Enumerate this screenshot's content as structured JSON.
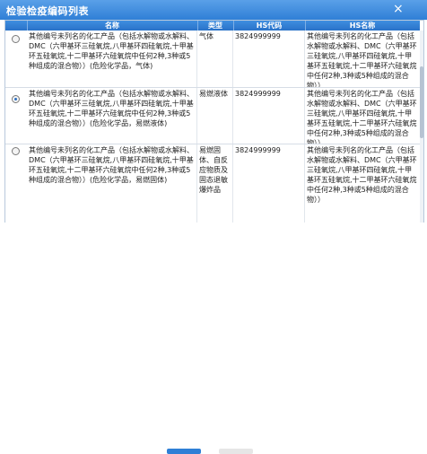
{
  "dialog": {
    "title": "检验检疫编码列表",
    "close_glyph": "×"
  },
  "table": {
    "headers": [
      "名称",
      "类型",
      "HS代码",
      "HS名称"
    ],
    "rows": [
      {
        "selected": false,
        "name": "其他编号未列名的化工产品（包括水解物或水解料、DMC（六甲基环三硅氧烷,八甲基环四硅氧烷,十甲基环五硅氧烷,十二甲基环六硅氧烷中任何2种,3种或5种组成的混合物））(危险化学品，气体)",
        "type": "气体",
        "hs_code": "3824999999",
        "hs_name": "其他编号未列名的化工产品（包括水解物或水解料、DMC（六甲基环三硅氧烷,八甲基环四硅氧烷,十甲基环五硅氧烷,十二甲基环六硅氧烷中任何2种,3种或5种组成的混合物））"
      },
      {
        "selected": true,
        "name": "其他编号未列名的化工产品（包括水解物或水解料、DMC（六甲基环三硅氧烷,八甲基环四硅氧烷,十甲基环五硅氧烷,十二甲基环六硅氧烷中任何2种,3种或5种组成的混合物））(危险化学品，易燃液体)",
        "type": "易燃液体",
        "hs_code": "3824999999",
        "hs_name": "其他编号未列名的化工产品（包括水解物或水解料、DMC（六甲基环三硅氧烷,八甲基环四硅氧烷,十甲基环五硅氧烷,十二甲基环六硅氧烷中任何2种,3种或5种组成的混合物））"
      },
      {
        "selected": false,
        "name": "其他编号未列名的化工产品（包括水解物或水解料、DMC（六甲基环三硅氧烷,八甲基环四硅氧烷,十甲基环五硅氧烷,十二甲基环六硅氧烷中任何2种,3种或5种组成的混合物））(危险化学品，易燃固体)",
        "type": "易燃固体、自反应物质及固态退敏爆炸品",
        "hs_code": "3824999999",
        "hs_name": "其他编号未列名的化工产品（包括水解物或水解料、DMC（六甲基环三硅氧烷,八甲基环四硅氧烷,十甲基环五硅氧烷,十二甲基环六硅氧烷中任何2种,3种或5种组成的混合物））"
      }
    ]
  },
  "colors": {
    "header_blue": "#2f7fd6",
    "button_primary": "#2f7fd6",
    "button_secondary": "#e6e6e6"
  }
}
